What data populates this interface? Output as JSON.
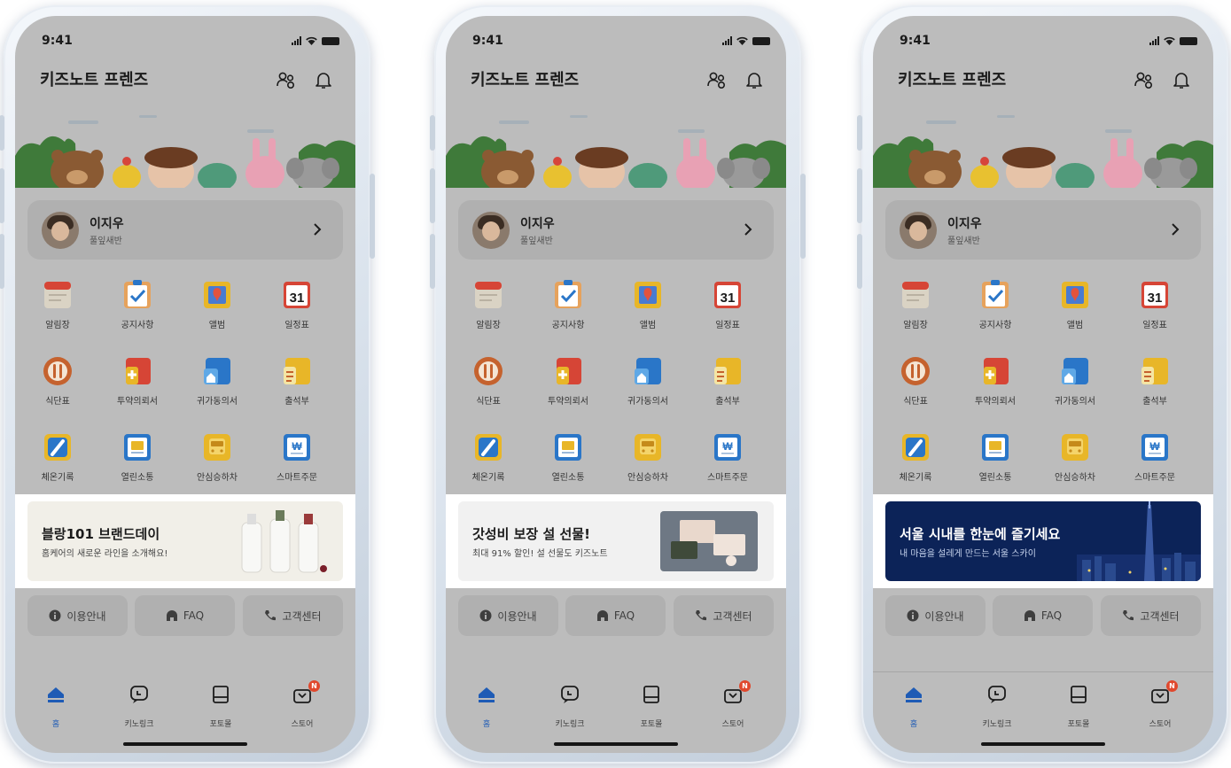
{
  "status": {
    "time": "9:41"
  },
  "header": {
    "app_title": "키즈노트 프렌즈"
  },
  "profile": {
    "name": "이지우",
    "class": "풀잎새반"
  },
  "menu": [
    {
      "label": "알림장",
      "icon": "notebook-icon"
    },
    {
      "label": "공지사항",
      "icon": "clipboard-check-icon"
    },
    {
      "label": "앨범",
      "icon": "photo-album-icon"
    },
    {
      "label": "일정표",
      "icon": "calendar-31-icon",
      "text": "31"
    },
    {
      "label": "식단표",
      "icon": "meal-icon"
    },
    {
      "label": "투약의뢰서",
      "icon": "medication-icon"
    },
    {
      "label": "귀가동의서",
      "icon": "home-consent-icon"
    },
    {
      "label": "출석부",
      "icon": "attendance-icon"
    },
    {
      "label": "체온기록",
      "icon": "thermometer-icon"
    },
    {
      "label": "열린소통",
      "icon": "open-talk-icon"
    },
    {
      "label": "안심승하차",
      "icon": "bus-icon"
    },
    {
      "label": "스마트주문",
      "icon": "smart-order-icon",
      "text": "₩"
    }
  ],
  "help": [
    {
      "label": "이용안내",
      "icon": "info-icon"
    },
    {
      "label": "FAQ",
      "icon": "faq-icon"
    },
    {
      "label": "고객센터",
      "icon": "phone-icon"
    }
  ],
  "tabs": [
    {
      "label": "홈",
      "icon": "home-icon"
    },
    {
      "label": "키노링크",
      "icon": "chat-link-icon"
    },
    {
      "label": "포토몰",
      "icon": "photo-book-icon"
    },
    {
      "label": "스토어",
      "icon": "store-bag-icon",
      "badge": "N"
    }
  ],
  "phones": [
    {
      "ad": {
        "title": "블랑101 브랜드데이",
        "subtitle": "홈케어의 새로운 라인을 소개해요!",
        "bg": "#f1efe8"
      }
    },
    {
      "ad": {
        "title": "갓성비 보장 설 선물!",
        "subtitle": "최대 91% 할인! 설 선물도 키즈노트",
        "bg": "#f1f1f1"
      }
    },
    {
      "ad": {
        "title": "서울 시내를 한눈에 즐기세요",
        "subtitle": "내 마음을 설레게 만드는 서울 스카이",
        "bg": "#0c2358"
      }
    }
  ],
  "colors": {
    "accent": "#1e5bb5",
    "badge": "#e0482d",
    "screen_dim": "#bcbcbc"
  }
}
